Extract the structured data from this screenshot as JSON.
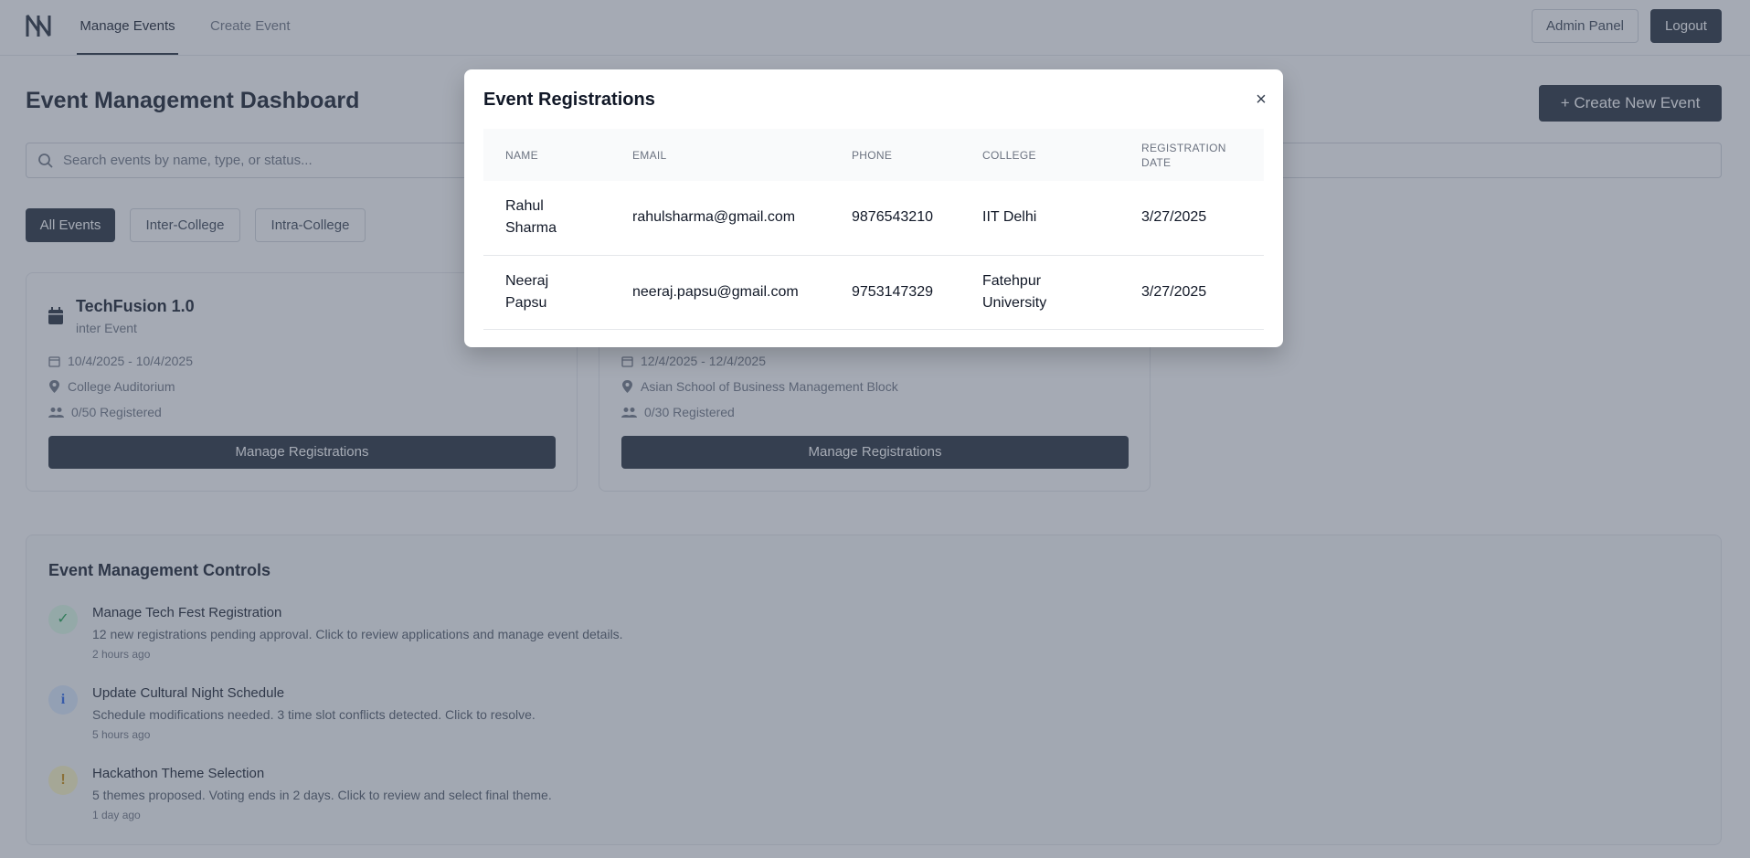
{
  "nav": {
    "tabs": [
      {
        "label": "Manage Events",
        "active": true
      },
      {
        "label": "Create Event",
        "active": false
      }
    ],
    "admin_label": "Admin Panel",
    "logout_label": "Logout"
  },
  "page": {
    "title": "Event Management Dashboard",
    "create_button": "+ Create New Event",
    "search_placeholder": "Search events by name, type, or status...",
    "filters": [
      "All Events",
      "Inter-College",
      "Intra-College"
    ]
  },
  "events": [
    {
      "title": "TechFusion 1.0",
      "subtitle": "inter Event",
      "dates": "10/4/2025 - 10/4/2025",
      "location": "College Auditorium",
      "registered": "0/50 Registered",
      "button": "Manage Registrations"
    },
    {
      "title": "",
      "subtitle": "",
      "dates": "12/4/2025 - 12/4/2025",
      "location": "Asian School of Business Management Block",
      "registered": "0/30 Registered",
      "button": "Manage Registrations"
    }
  ],
  "controls": {
    "title": "Event Management Controls",
    "items": [
      {
        "icon": "check-icon",
        "title": "Manage Tech Fest Registration",
        "desc": "12 new registrations pending approval. Click to review applications and manage event details.",
        "time": "2 hours ago",
        "color": "#16a34a"
      },
      {
        "icon": "info-icon",
        "title": "Update Cultural Night Schedule",
        "desc": "Schedule modifications needed. 3 time slot conflicts detected. Click to resolve.",
        "time": "5 hours ago",
        "color": "#2563eb"
      },
      {
        "icon": "exclamation-icon",
        "title": "Hackathon Theme Selection",
        "desc": "5 themes proposed. Voting ends in 2 days. Click to review and select final theme.",
        "time": "1 day ago",
        "color": "#ca8a04"
      }
    ]
  },
  "modal": {
    "title": "Event Registrations",
    "close": "×",
    "columns": [
      "NAME",
      "EMAIL",
      "PHONE",
      "COLLEGE",
      "REGISTRATION DATE"
    ],
    "rows": [
      [
        "Rahul Sharma",
        "rahulsharma@gmail.com",
        "9876543210",
        "IIT Delhi",
        "3/27/2025"
      ],
      [
        "Neeraj Papsu",
        "neeraj.papsu@gmail.com",
        "9753147329",
        "Fatehpur University",
        "3/27/2025"
      ]
    ]
  },
  "colors": {
    "accent": "#1f2937",
    "overlay": "rgba(75,85,105,0.5)"
  }
}
